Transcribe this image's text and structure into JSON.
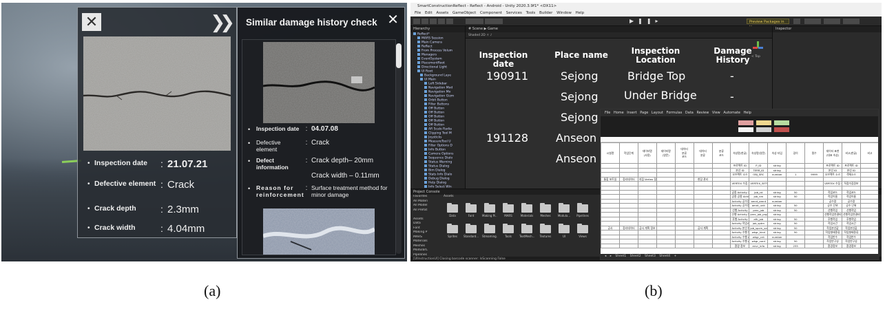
{
  "captions": {
    "a": "(a)",
    "b": "(b)"
  },
  "panel_a": {
    "info_card": {
      "close_icon": "close-icon",
      "next_icon": "double-chevron-right-icon",
      "rows": [
        {
          "label": "Inspection  date",
          "value": "21.07.21"
        },
        {
          "label": "Defective element",
          "value": "Crack"
        },
        {
          "label": "Crack depth",
          "value": "2.3mm"
        },
        {
          "label": "Crack width",
          "value": "4.04mm"
        }
      ]
    },
    "similar_card": {
      "title": "Similar damage history check",
      "close_icon": "close-icon",
      "rows": [
        {
          "label": "Inspection date",
          "value": "04.07.08"
        },
        {
          "label": "Defective element",
          "value": "Crack"
        },
        {
          "label": "Defect information",
          "value": "Crack depth– 20mm"
        },
        {
          "label": "",
          "value": "Crack width – 0.11mm"
        },
        {
          "label": "Reason for reinforcement",
          "value": "Surface treatment method for minor damage"
        }
      ]
    }
  },
  "panel_b": {
    "title_bar": "SmartConstructionReflect - Reflect - Android - Unity 2020.3.9f1* <DX11>",
    "menu": "File Edit Assets GameObject Component Services Tools Builder Window Help",
    "preview_button": "Preview Packages in Use ▾",
    "hierarchy_title": "Hierarchy",
    "hierarchy_items": [
      "Reflect*",
      "MARS Session",
      "Main Camera",
      "Reflect",
      "From Process Volum",
      "Managers",
      "EventSystem",
      "PlacementRoot",
      "Directional Light",
      "UI Root",
      "Background Laye",
      "UI Main",
      "Left Sidebar",
      "Navigation Mod",
      "Navigation Mo",
      "Navigation Gizm",
      "Orbit Button",
      "Filter Buttons",
      "Off Button",
      "Off Button",
      "Off Button",
      "Off Button",
      "Off Button",
      "AR Scale Radia",
      "Clipping Tool M",
      "Joysticks",
      "MeasureTool U",
      "Filter Options D",
      "Info Button",
      "Camera Options",
      "Sequence Dialo",
      "Status Warning",
      "Status Dialog",
      "Bim Dialog",
      "Stats Info Dialo",
      "Debug Dialog",
      "Help Dialog",
      "Info Select Win",
      "Navigation Swi",
      "Landing Screen",
      "AppBar",
      "Scene Options"
    ],
    "scene_tabs": "# Scene   ▶ Game",
    "scene_toolbar": "Shaded   2D   ☼   ♪",
    "scene_table": {
      "headers": [
        "Inspection date",
        "Place name",
        "Inspection Location",
        "Damage History"
      ],
      "rows": [
        [
          "190911",
          "Sejong",
          "Bridge Top",
          "-"
        ],
        [
          "",
          "Sejong",
          "Under Bridge",
          "-"
        ],
        [
          "",
          "Sejong",
          "",
          ""
        ],
        [
          "191128",
          "Anseon",
          "",
          ""
        ],
        [
          "",
          "Anseon",
          "",
          ""
        ]
      ]
    },
    "gizmo_label": "< Top",
    "inspector_title": "Inspector",
    "project_title": "Project   Console",
    "project_tree": [
      "Favorites",
      "All Materi",
      "All Model",
      "All Prefat",
      "",
      "Assets",
      "Data",
      "Font",
      "Making P",
      "MARS",
      "Materials",
      "Meshes",
      "ModularL",
      "Pipelines",
      "Resource",
      "Samples",
      "Scenes",
      "Scripts",
      "Shaders",
      "Sprites"
    ],
    "assets_header": "Assets",
    "folders_row1": [
      "Data",
      "Font",
      "Making Pi...",
      "MARS",
      "Materials",
      "Meshes",
      "Modula...",
      "Pipelines"
    ],
    "folders_row2": [
      "Sprites",
      "Standard...",
      "Streaming...",
      "Tools",
      "TextMesh...",
      "Textures",
      "UI",
      "Views"
    ],
    "status": "[UIInstructionUI] Closing barcode scanner: IsScanning False",
    "excel": {
      "ribbon_tabs": "File  Home  Insert  Page Layout  Formulas  Data  Review  View  Automate  Help",
      "sheet_tabs": "◂ ▸  Sheet1  Sheet2  Sheet3  Sheet4  +",
      "header_row": [
        "시설명",
        "작업단계",
        "데이터명\n(사용)",
        "데이터명\n(영문)",
        "데이터\n분류\n코드",
        "데이터\n분류",
        "분류\n코드",
        "속성명(한글)",
        "속성명(영문)",
        "속성 타입",
        "길이",
        "필수",
        "데이터 표현\n(대표 속성)",
        "비고(한글)",
        "비고"
      ],
      "rows": [
        [
          "",
          "",
          "",
          "",
          "",
          "",
          "",
          "프로젝트 ID",
          "P_ID",
          "string",
          "",
          "",
          "프로젝트 ID",
          "프로젝트 ID",
          ""
        ],
        [
          "",
          "",
          "",
          "",
          "",
          "",
          "",
          "본선 ID",
          "TERR_ID",
          "string",
          "",
          "",
          "본선 ID",
          "본선 ID",
          ""
        ],
        [
          "",
          "",
          "",
          "",
          "",
          "",
          "",
          "오브젝트 소스",
          "OBJ_SRC",
          "number",
          "1",
          "9999",
          "오브젝트 소스",
          "객체소스",
          ""
        ],
        [
          "통합 포트일",
          "정리데이터",
          "지점 Vertex 정보",
          "",
          "",
          "현장 관리",
          "",
          "",
          "",
          "",
          "",
          "",
          "",
          "",
          ""
        ],
        [
          "",
          "",
          "",
          "",
          "",
          "",
          "",
          "VERTEX 수집 정보",
          "VERTEX_SETS",
          "",
          "",
          "",
          "VERTEX 수집 정보",
          "직접수집정보",
          ""
        ],
        [
          "",
          "",
          "",
          "",
          "",
          "",
          "",
          "",
          "",
          "",
          "",
          "",
          "",
          "",
          ""
        ],
        [
          "",
          "",
          "",
          "",
          "",
          "",
          "",
          "공종 Activity 코드",
          "job_cd",
          "string",
          "50",
          "",
          "작업코드",
          "작업코드",
          ""
        ],
        [
          "",
          "",
          "",
          "",
          "",
          "",
          "",
          "공종 공종 Activity 명",
          "job_nm",
          "string",
          "50",
          "",
          "작업이름",
          "작업이름",
          ""
        ],
        [
          "",
          "",
          "",
          "",
          "",
          "",
          "",
          "Activity 공수량",
          "amnt_amnt",
          "number",
          "",
          "",
          "공수량",
          "공수량",
          ""
        ],
        [
          "",
          "",
          "",
          "",
          "",
          "",
          "",
          "Activity 공수량 단위",
          "amnt_unit",
          "string",
          "50",
          "",
          "공수 단위",
          "공수 단위",
          ""
        ],
        [
          "",
          "",
          "",
          "",
          "",
          "",
          "",
          "선행 Activity",
          "prec_job",
          "string",
          "50",
          "",
          "선행작업",
          "선행작업",
          ""
        ],
        [
          "",
          "",
          "",
          "",
          "",
          "",
          "",
          "선행 Activity 연결타입",
          "prec_job_prgs_r",
          "string",
          "",
          "",
          "선행작업연결타입",
          "선행작업연결타입",
          ""
        ],
        [
          "",
          "",
          "",
          "",
          "",
          "",
          "",
          "후행 Activity",
          "afti_job",
          "string",
          "50",
          "",
          "후행작업",
          "후행작업",
          ""
        ],
        [
          "",
          "",
          "",
          "",
          "",
          "",
          "",
          "Activity 작업시간",
          "job_sptm",
          "string",
          "50",
          "",
          "작업시간",
          "작업시간",
          ""
        ],
        [
          "공사",
          "정리데이터",
          "공사 계획 정보",
          "",
          "",
          "공사 계획",
          "",
          "Activity 본선 데이터",
          "job_spcm_val",
          "string",
          "50",
          "",
          "작업본선값",
          "작업본선값",
          ""
        ],
        [
          "",
          "",
          "",
          "",
          "",
          "",
          "",
          "Activity 수행 형태",
          "wkgr_kind",
          "string",
          "50",
          "",
          "작업형태종류",
          "작업형태종류",
          ""
        ],
        [
          "",
          "",
          "",
          "",
          "",
          "",
          "",
          "Activity 수행 crew 수",
          "wkgr_cnt",
          "number",
          "",
          "",
          "작업반수",
          "작업반수",
          ""
        ],
        [
          "",
          "",
          "",
          "",
          "",
          "",
          "",
          "Activity 수행 crew 구성",
          "wkgr_cont",
          "string",
          "50",
          "",
          "작업반구성",
          "작업반구성",
          ""
        ],
        [
          "",
          "",
          "",
          "",
          "",
          "",
          "",
          "환경 정보",
          "envr_info",
          "string",
          "255",
          "",
          "환경정보",
          "환경정보",
          ""
        ]
      ]
    }
  },
  "colors": {
    "accent_green": "#8ccf5a",
    "unity_dark": "#383838",
    "preview_yellow": "#e6c85a"
  }
}
